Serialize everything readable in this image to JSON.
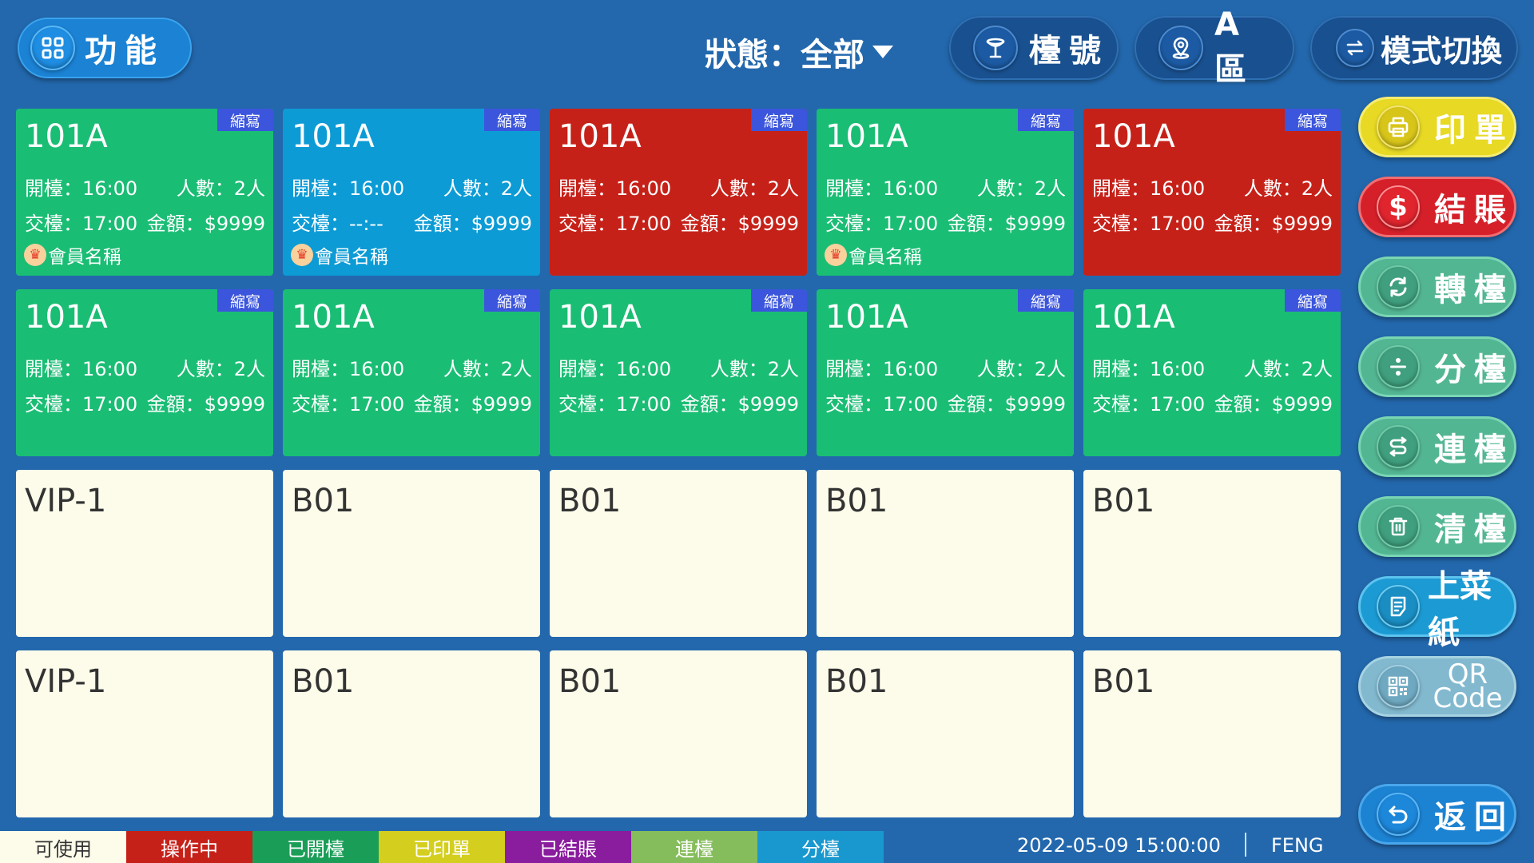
{
  "header": {
    "function_label": "功能",
    "status_label": "狀態：全部",
    "table_label": "檯號",
    "area_label": "A 區",
    "mode_label": "模式切換"
  },
  "cards": [
    {
      "number": "101A",
      "tag": "縮寫",
      "color": "green",
      "open": "開檯：16:00",
      "people": "人數：2人",
      "close": "交檯：17:00",
      "amount": "金額：$9999",
      "member": "會員名稱"
    },
    {
      "number": "101A",
      "tag": "縮寫",
      "color": "blue",
      "open": "開檯：16:00",
      "people": "人數：2人",
      "close": "交檯：--:--",
      "amount": "金額：$9999",
      "member": "會員名稱"
    },
    {
      "number": "101A",
      "tag": "縮寫",
      "color": "red",
      "open": "開檯：16:00",
      "people": "人數：2人",
      "close": "交檯：17:00",
      "amount": "金額：$9999",
      "member": ""
    },
    {
      "number": "101A",
      "tag": "縮寫",
      "color": "green",
      "open": "開檯：16:00",
      "people": "人數：2人",
      "close": "交檯：17:00",
      "amount": "金額：$9999",
      "member": "會員名稱"
    },
    {
      "number": "101A",
      "tag": "縮寫",
      "color": "red",
      "open": "開檯：16:00",
      "people": "人數：2人",
      "close": "交檯：17:00",
      "amount": "金額：$9999",
      "member": ""
    },
    {
      "number": "101A",
      "tag": "縮寫",
      "color": "green",
      "open": "開檯：16:00",
      "people": "人數：2人",
      "close": "交檯：17:00",
      "amount": "金額：$9999",
      "member": ""
    },
    {
      "number": "101A",
      "tag": "縮寫",
      "color": "green",
      "open": "開檯：16:00",
      "people": "人數：2人",
      "close": "交檯：17:00",
      "amount": "金額：$9999",
      "member": ""
    },
    {
      "number": "101A",
      "tag": "縮寫",
      "color": "green",
      "open": "開檯：16:00",
      "people": "人數：2人",
      "close": "交檯：17:00",
      "amount": "金額：$9999",
      "member": ""
    },
    {
      "number": "101A",
      "tag": "縮寫",
      "color": "green",
      "open": "開檯：16:00",
      "people": "人數：2人",
      "close": "交檯：17:00",
      "amount": "金額：$9999",
      "member": ""
    },
    {
      "number": "101A",
      "tag": "縮寫",
      "color": "green",
      "open": "開檯：16:00",
      "people": "人數：2人",
      "close": "交檯：17:00",
      "amount": "金額：$9999",
      "member": ""
    },
    {
      "number": "VIP-1",
      "color": "empty"
    },
    {
      "number": "B01",
      "color": "empty"
    },
    {
      "number": "B01",
      "color": "empty"
    },
    {
      "number": "B01",
      "color": "empty"
    },
    {
      "number": "B01",
      "color": "empty"
    },
    {
      "number": "VIP-1",
      "color": "empty"
    },
    {
      "number": "B01",
      "color": "empty"
    },
    {
      "number": "B01",
      "color": "empty"
    },
    {
      "number": "B01",
      "color": "empty"
    },
    {
      "number": "B01",
      "color": "empty"
    }
  ],
  "side": {
    "print": "印單",
    "checkout": "結賬",
    "transfer": "轉檯",
    "split": "分檯",
    "link": "連檯",
    "clear": "清檯",
    "menu": "上菜紙",
    "qr": "QR Code",
    "back": "返回"
  },
  "legend": [
    {
      "label": "可使用",
      "bg": "#fdfcea",
      "fg": "#333333"
    },
    {
      "label": "操作中",
      "bg": "#c62119",
      "fg": "#ffffff"
    },
    {
      "label": "已開檯",
      "bg": "#1a9e57",
      "fg": "#ffffff"
    },
    {
      "label": "已印單",
      "bg": "#d4ce1f",
      "fg": "#ffffff"
    },
    {
      "label": "已結賬",
      "bg": "#8a1c9e",
      "fg": "#ffffff"
    },
    {
      "label": "連檯",
      "bg": "#86bd5c",
      "fg": "#ffffff"
    },
    {
      "label": "分檯",
      "bg": "#1997cf",
      "fg": "#ffffff"
    }
  ],
  "footer": {
    "datetime": "2022-05-09 15:00:00",
    "user": "FENG"
  },
  "icons": {
    "function": "grid-icon",
    "table": "cocktail-icon",
    "area": "location-pin-icon",
    "mode": "swap-icon",
    "print": "printer-icon",
    "checkout": "dollar-icon",
    "transfer": "refresh-icon",
    "split": "divide-icon",
    "link": "link-icon",
    "clear": "trash-icon",
    "menu": "document-icon",
    "qr": "qr-code-icon",
    "back": "back-arrow-icon"
  }
}
